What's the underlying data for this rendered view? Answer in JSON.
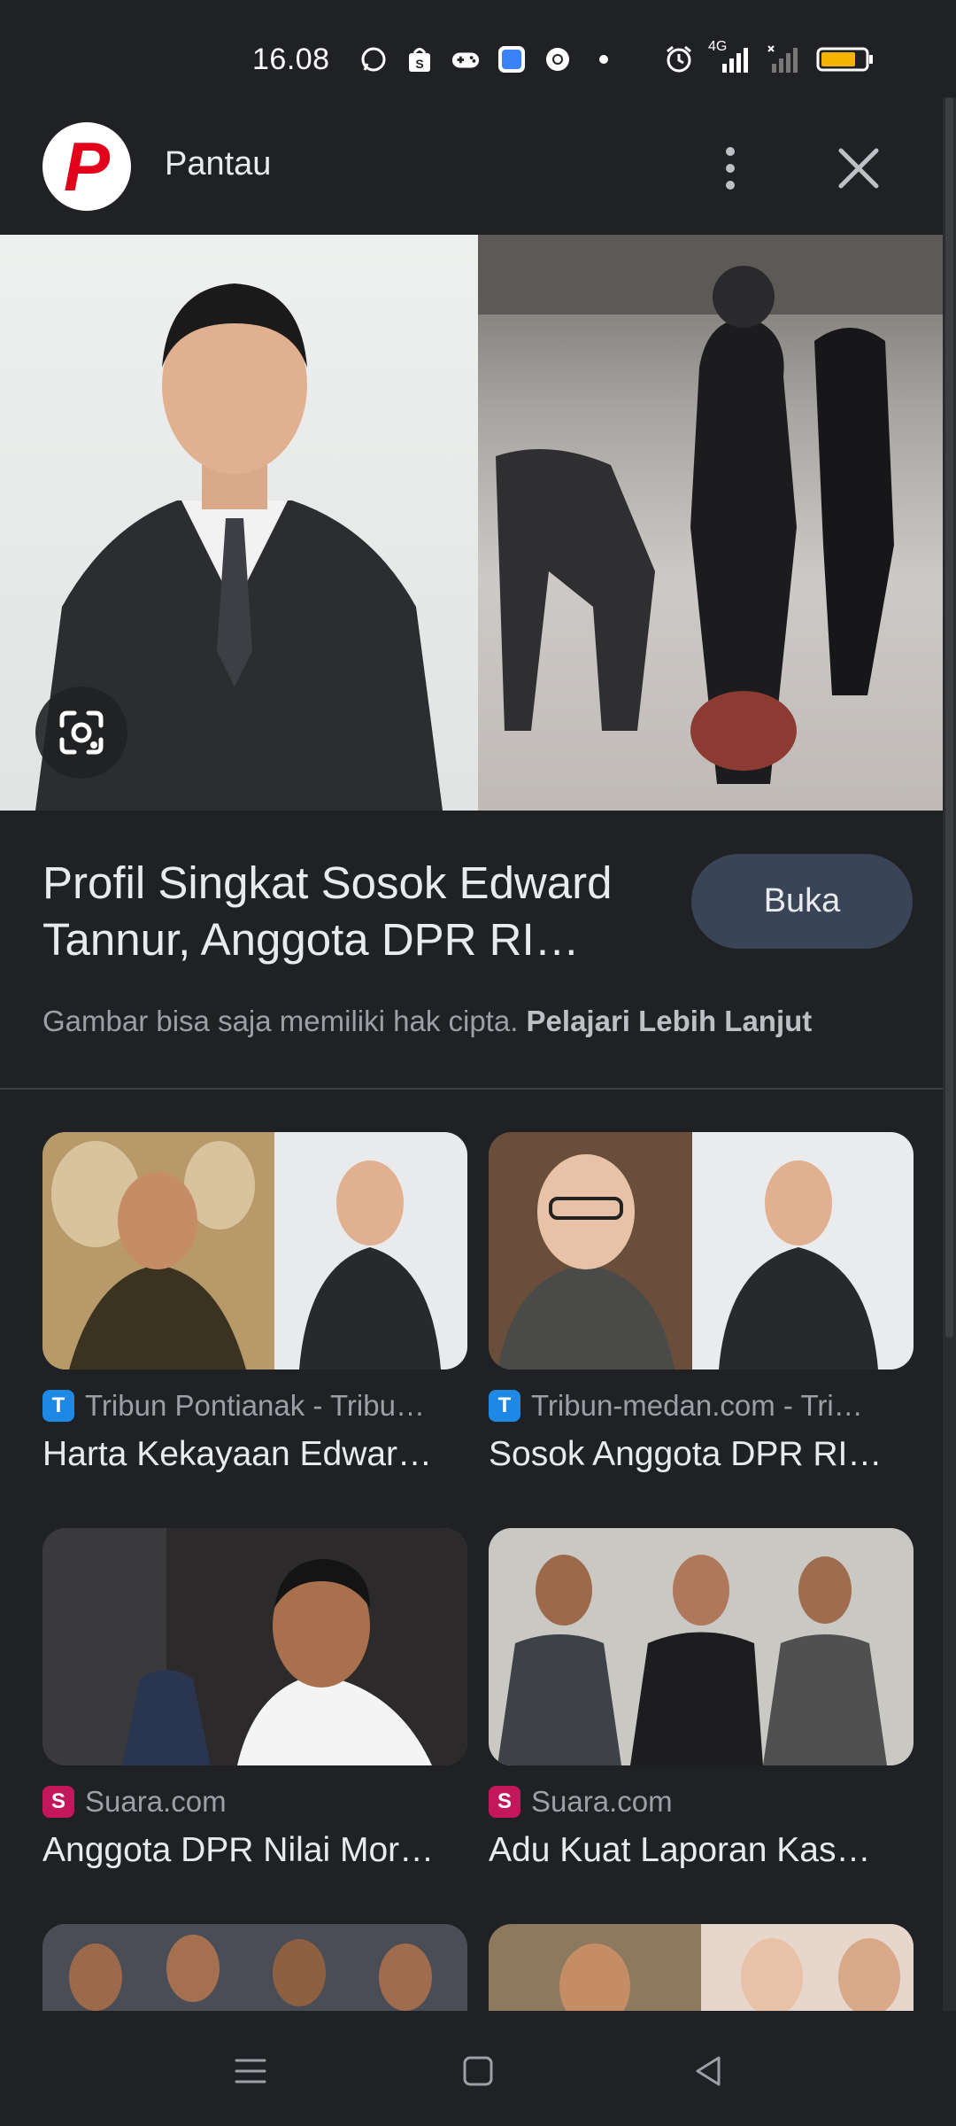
{
  "status_bar": {
    "time": "16.08",
    "network_label": "4G",
    "icons": [
      "whatsapp-icon",
      "shopee-icon",
      "gamepad-icon",
      "app-icon",
      "chrome-icon",
      "dot-icon",
      "alarm-icon",
      "signal-icon",
      "signal-empty-icon",
      "battery-icon"
    ]
  },
  "header": {
    "site_name": "Pantau",
    "logo_letter": "P"
  },
  "result": {
    "title": "Profil Singkat Sosok Edward Tannur, Anggota DPR RI…",
    "open_button": "Buka",
    "copyright_text": "Gambar bisa saja memiliki hak cipta.",
    "learn_more": "Pelajari Lebih Lanjut"
  },
  "related": [
    {
      "source": "Tribun Pontianak - Tribu…",
      "title": "Harta Kekayaan Edwar…",
      "icon_letter": "T",
      "icon_color": "#1e88e5"
    },
    {
      "source": "Tribun-medan.com - Tri…",
      "title": "Sosok Anggota DPR RI…",
      "icon_letter": "T",
      "icon_color": "#1e88e5"
    },
    {
      "source": "Suara.com",
      "title": "Anggota DPR Nilai Mor…",
      "icon_letter": "S",
      "icon_color": "#c2185b"
    },
    {
      "source": "Suara.com",
      "title": "Adu Kuat Laporan Kas…",
      "icon_letter": "S",
      "icon_color": "#c2185b"
    }
  ],
  "colors": {
    "background": "#202124",
    "button_bg": "#394457",
    "brand_red": "#e3001b"
  }
}
